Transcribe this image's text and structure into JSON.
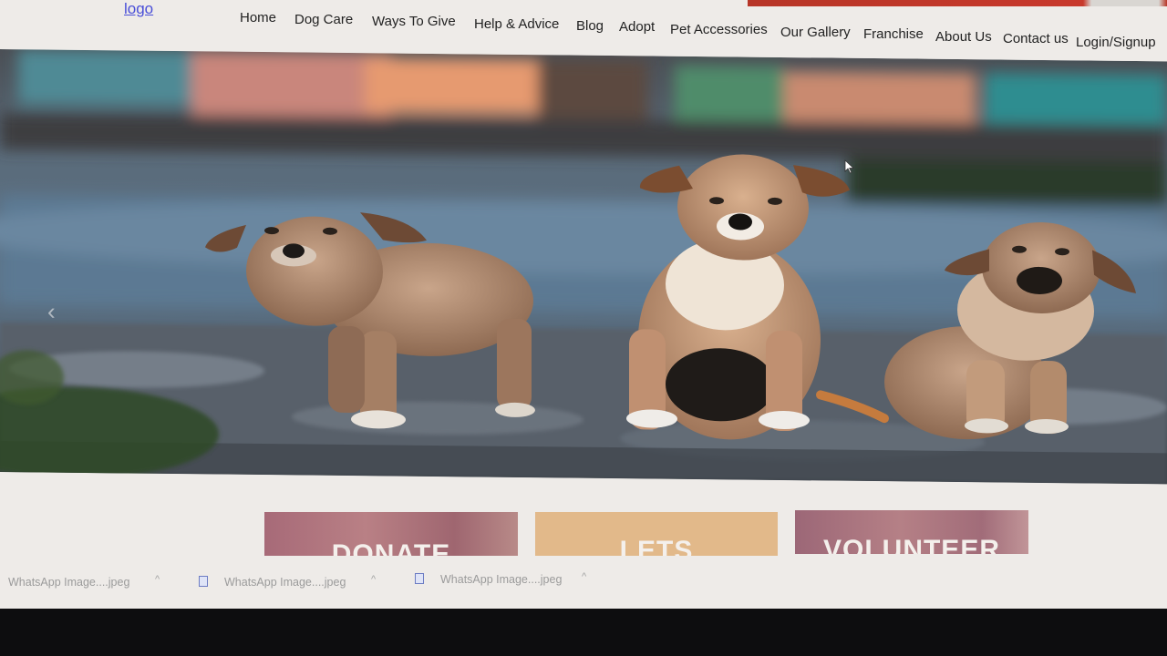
{
  "header": {
    "logo_text": "logo",
    "nav": [
      "Home",
      "Dog Care",
      "Ways To Give",
      "Help & Advice",
      "Blog",
      "Adopt",
      "Pet Accessories",
      "Our Gallery",
      "Franchise",
      "About Us",
      "Contact us",
      "Login/Signup"
    ]
  },
  "hero": {
    "image_description": "three puppies on gravel",
    "prev_arrow": "‹"
  },
  "cards": [
    {
      "label": "DONATE"
    },
    {
      "label": "LETS"
    },
    {
      "label": "VOLUNTEER"
    }
  ],
  "downloads": {
    "items": [
      {
        "name": "WhatsApp Image....jpeg"
      },
      {
        "name": "WhatsApp Image....jpeg"
      },
      {
        "name": "WhatsApp Image....jpeg"
      }
    ],
    "caret": "^"
  },
  "colors": {
    "accent_red": "#c8392c",
    "logo_link": "#4a4fd8",
    "card_lets": "#e2b98a"
  }
}
